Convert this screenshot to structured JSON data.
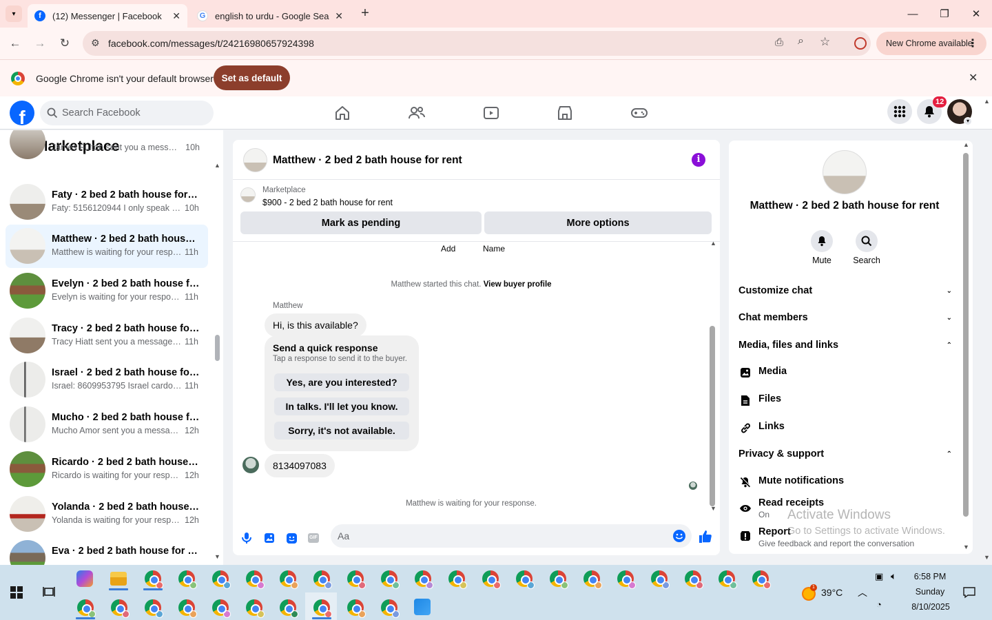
{
  "browser": {
    "tabs": [
      {
        "title": "(12) Messenger | Facebook",
        "active": true
      },
      {
        "title": "english to urdu - Google Search",
        "active": false
      }
    ],
    "url": "facebook.com/messages/t/24216980657924398",
    "new_chrome_label": "New Chrome available",
    "infobar_message": "Google Chrome isn't your default browser",
    "set_default_label": "Set as default"
  },
  "fb": {
    "search_placeholder": "Search Facebook",
    "notification_count": "12"
  },
  "sidebar": {
    "title": "Marketplace",
    "conversations": [
      {
        "name": "",
        "preview": "James Fulton sent you a message ...",
        "time": "10h",
        "selected": false
      },
      {
        "name": "Faty · 2 bed 2 bath house for rent",
        "preview": "Faty: 5156120944 I only speak Sp...",
        "time": "10h",
        "selected": false
      },
      {
        "name": "Matthew · 2 bed 2 bath house f...",
        "preview": "Matthew is waiting for your respo...",
        "time": "11h",
        "selected": true
      },
      {
        "name": "Evelyn · 2 bed 2 bath house for ...",
        "preview": "Evelyn is waiting for your response.",
        "time": "11h",
        "selected": false
      },
      {
        "name": "Tracy · 2 bed 2 bath house for re...",
        "preview": "Tracy Hiatt sent you a message ab...",
        "time": "11h",
        "selected": false
      },
      {
        "name": "Israel · 2 bed 2 bath house for r...",
        "preview": "Israel: 8609953795 Israel cardona ...",
        "time": "11h",
        "selected": false
      },
      {
        "name": "Mucho · 2 bed 2 bath house for ...",
        "preview": "Mucho Amor sent you a message ...",
        "time": "12h",
        "selected": false
      },
      {
        "name": "Ricardo · 2 bed 2 bath house for...",
        "preview": "Ricardo is waiting for your respon...",
        "time": "12h",
        "selected": false
      },
      {
        "name": "Yolanda · 2 bed 2 bath house fo...",
        "preview": "Yolanda is waiting for your respo...",
        "time": "12h",
        "selected": false
      },
      {
        "name": "Eva · 2 bed 2 bath house for rent",
        "preview": "",
        "time": "",
        "selected": false
      }
    ]
  },
  "chat": {
    "title": "Matthew · 2 bed 2 bath house for rent",
    "listing_source": "Marketplace",
    "listing_text": "$900 - 2 bed 2 bath house for rent",
    "mark_pending_label": "Mark as pending",
    "more_options_label": "More options",
    "top_labels": [
      "Add",
      "Name"
    ],
    "started_text": "Matthew started this chat.",
    "view_buyer_label": "View buyer profile",
    "sender_name": "Matthew",
    "first_message": "Hi, is this available?",
    "quick_title": "Send a quick response",
    "quick_subtitle": "Tap a response to send it to the buyer.",
    "quick_replies": [
      "Yes, are you interested?",
      "In talks. I'll let you know.",
      "Sorry, it's not available."
    ],
    "phone_message": "8134097083",
    "waiting_text": "Matthew is waiting for your response.",
    "input_placeholder": "Aa"
  },
  "info_panel": {
    "title": "Matthew · 2 bed 2 bath house for rent",
    "actions": [
      "Mute",
      "Search"
    ],
    "sections": [
      "Customize chat",
      "Chat members",
      "Media, files and links",
      "Privacy & support"
    ],
    "media_items": [
      "Media",
      "Files",
      "Links"
    ],
    "privacy_items": [
      {
        "label": "Mute notifications",
        "sub": ""
      },
      {
        "label": "Read receipts",
        "sub": "On"
      },
      {
        "label": "Report",
        "sub": "Give feedback and report the conversation"
      }
    ]
  },
  "watermark": {
    "line1": "Activate Windows",
    "line2": "Go to Settings to activate Windows."
  },
  "taskbar": {
    "weather_temp": "39°C",
    "weather_badge": "1",
    "time": "6:58 PM",
    "day": "Sunday",
    "date": "8/10/2025"
  },
  "colors": {
    "fb_blue": "#0866ff",
    "chrome_tab_bg": "#fde3e1",
    "set_default_bg": "#8c3e2c",
    "selected_conv_bg": "#ebf5ff",
    "info_purple": "#8a0fd8",
    "notif_red": "#e41e3f"
  }
}
